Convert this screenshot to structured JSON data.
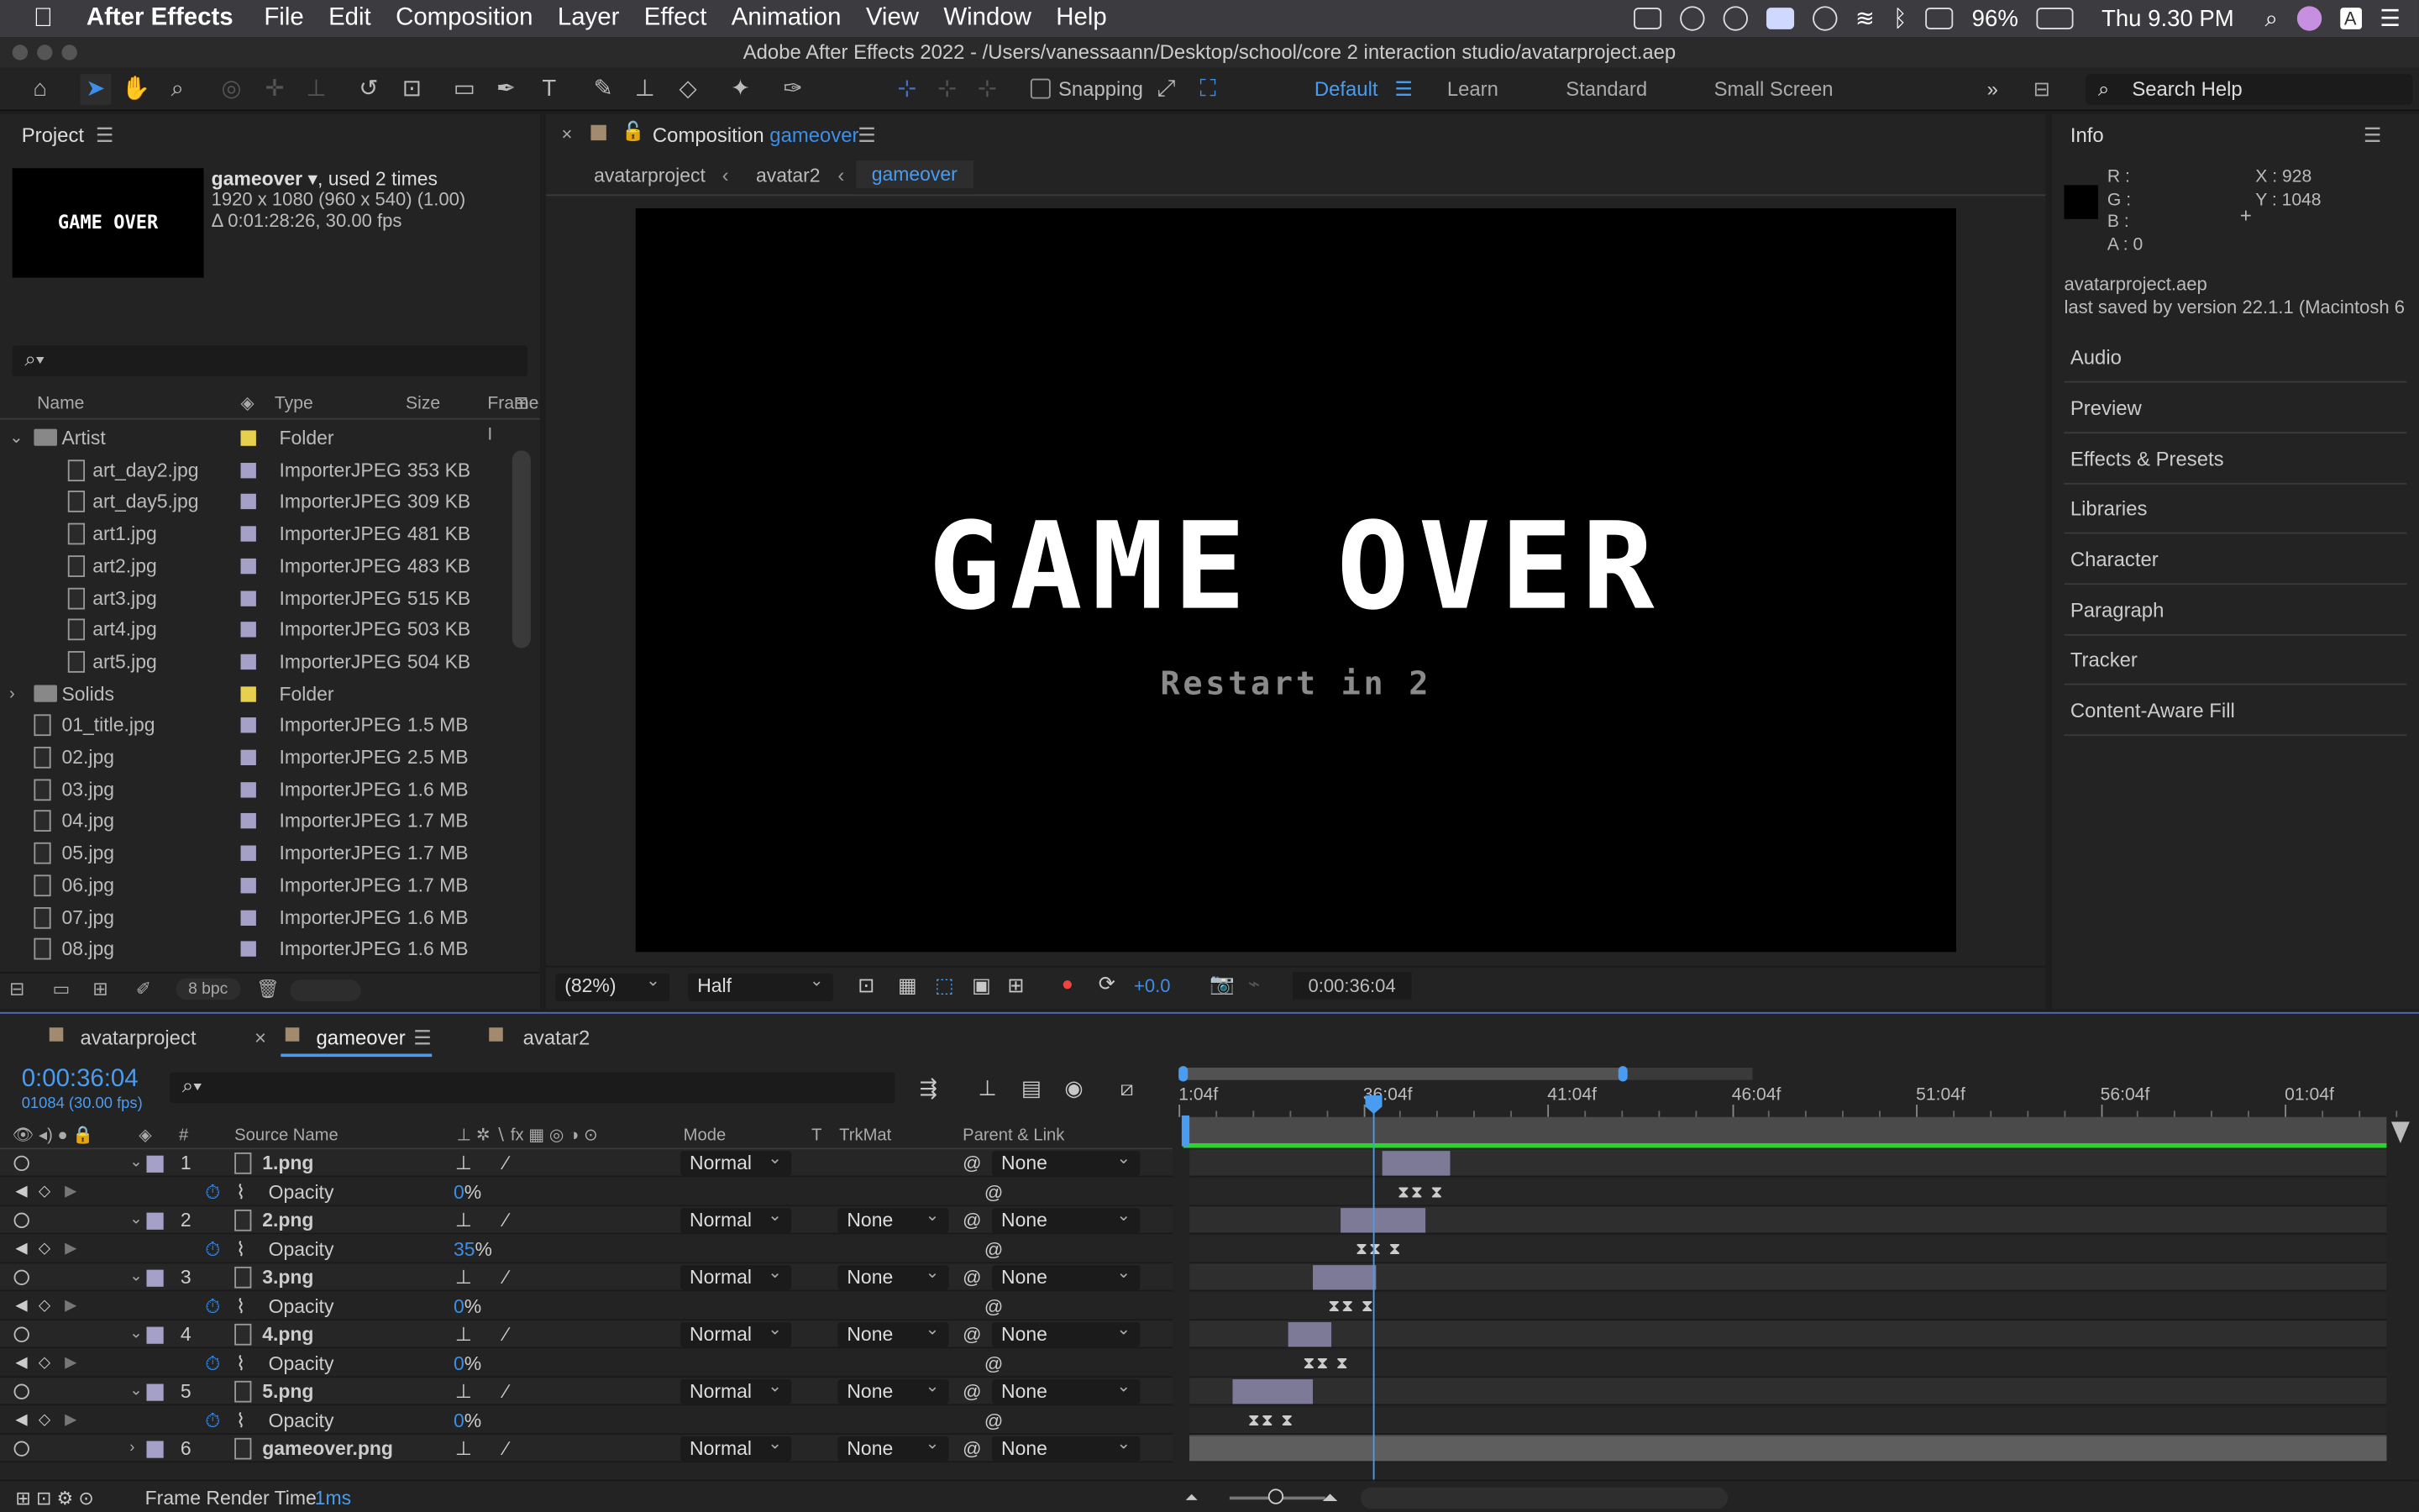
{
  "menubar": {
    "app_name": "After Effects",
    "items": [
      "File",
      "Edit",
      "Composition",
      "Layer",
      "Effect",
      "Animation",
      "View",
      "Window",
      "Help"
    ],
    "battery": "96%",
    "clock": "Thu 9.30 PM"
  },
  "window": {
    "title": "Adobe After Effects 2022 - /Users/vanessaann/Desktop/school/core 2 interaction studio/avatarproject.aep"
  },
  "toolbar": {
    "snapping": "Snapping",
    "workspaces": [
      "Default",
      "Learn",
      "Standard",
      "Small Screen"
    ],
    "search_placeholder": "Search Help"
  },
  "project": {
    "title": "Project",
    "comp_name": "gameover",
    "used": ", used 2 times",
    "dims": "1920 x 1080  (960 x 540) (1.00)",
    "duration": "Δ 0:01:28:26, 30.00 fps",
    "thumb_text": "GAME OVER",
    "columns": [
      "Name",
      "Type",
      "Size",
      "Frame I"
    ],
    "bpc": "8 bpc",
    "items": [
      {
        "name": "Artist",
        "type": "Folder",
        "size": "",
        "folder": true,
        "label_color": "#e6d04e"
      },
      {
        "name": "art_day2.jpg",
        "type": "ImporterJPEG",
        "size": "353 KB"
      },
      {
        "name": "art_day5.jpg",
        "type": "ImporterJPEG",
        "size": "309 KB"
      },
      {
        "name": "art1.jpg",
        "type": "ImporterJPEG",
        "size": "481 KB"
      },
      {
        "name": "art2.jpg",
        "type": "ImporterJPEG",
        "size": "483 KB"
      },
      {
        "name": "art3.jpg",
        "type": "ImporterJPEG",
        "size": "515 KB"
      },
      {
        "name": "art4.jpg",
        "type": "ImporterJPEG",
        "size": "503 KB"
      },
      {
        "name": "art5.jpg",
        "type": "ImporterJPEG",
        "size": "504 KB"
      },
      {
        "name": "Solids",
        "type": "Folder",
        "size": "",
        "folder": true,
        "label_color": "#e6d04e"
      },
      {
        "name": "01_title.jpg",
        "type": "ImporterJPEG",
        "size": "1.5 MB"
      },
      {
        "name": "02.jpg",
        "type": "ImporterJPEG",
        "size": "2.5 MB"
      },
      {
        "name": "03.jpg",
        "type": "ImporterJPEG",
        "size": "1.6 MB"
      },
      {
        "name": "04.jpg",
        "type": "ImporterJPEG",
        "size": "1.7 MB"
      },
      {
        "name": "05.jpg",
        "type": "ImporterJPEG",
        "size": "1.7 MB"
      },
      {
        "name": "06.jpg",
        "type": "ImporterJPEG",
        "size": "1.7 MB"
      },
      {
        "name": "07.jpg",
        "type": "ImporterJPEG",
        "size": "1.6 MB"
      },
      {
        "name": "08.jpg",
        "type": "ImporterJPEG",
        "size": "1.6 MB"
      }
    ]
  },
  "comp": {
    "label": "Composition",
    "name": "gameover",
    "breadcrumbs": [
      "avatarproject",
      "avatar2",
      "gameover"
    ],
    "headline": "GAME OVER",
    "subline": "Restart in 2",
    "zoom": "(82%)",
    "resolution": "Half",
    "exposure": "+0.0",
    "timecode": "0:00:36:04"
  },
  "info": {
    "title": "Info",
    "r": "R :",
    "g": "G :",
    "b": "B :",
    "a": "A :  0",
    "x": "X : 928",
    "y": "Y : 1048",
    "file": "avatarproject.aep",
    "saved": "last saved by version 22.1.1 (Macintosh 6",
    "panels": [
      "Audio",
      "Preview",
      "Effects & Presets",
      "Libraries",
      "Character",
      "Paragraph",
      "Tracker",
      "Content-Aware Fill"
    ]
  },
  "timeline": {
    "tabs": [
      "avatarproject",
      "gameover",
      "avatar2"
    ],
    "timecode": "0:00:36:04",
    "frames": "01084 (30.00 fps)",
    "columns": [
      "Source Name",
      "Mode",
      "T",
      "TrkMat",
      "Parent & Link"
    ],
    "ruler": [
      "1:04f",
      "36:04f",
      "41:04f",
      "46:04f",
      "51:04f",
      "56:04f",
      "01:04f"
    ],
    "footer": "Frame Render Time",
    "render_time": "1ms",
    "layers": [
      {
        "num": "1",
        "name": "1.png",
        "mode": "Normal",
        "trkmat": "",
        "parent": "None",
        "prop": "Opacity",
        "prop_value": "0",
        "bar_start": 0.161,
        "bar_len": 0.057
      },
      {
        "num": "2",
        "name": "2.png",
        "mode": "Normal",
        "trkmat": "None",
        "parent": "None",
        "prop": "Opacity",
        "prop_value": "35",
        "bar_start": 0.126,
        "bar_len": 0.071
      },
      {
        "num": "3",
        "name": "3.png",
        "mode": "Normal",
        "trkmat": "None",
        "parent": "None",
        "prop": "Opacity",
        "prop_value": "0",
        "bar_start": 0.103,
        "bar_len": 0.053
      },
      {
        "num": "4",
        "name": "4.png",
        "mode": "Normal",
        "trkmat": "None",
        "parent": "None",
        "prop": "Opacity",
        "prop_value": "0",
        "bar_start": 0.082,
        "bar_len": 0.037
      },
      {
        "num": "5",
        "name": "5.png",
        "mode": "Normal",
        "trkmat": "None",
        "parent": "None",
        "prop": "Opacity",
        "prop_value": "0",
        "bar_start": 0.036,
        "bar_len": 0.067
      },
      {
        "num": "6",
        "name": "gameover.png",
        "mode": "Normal",
        "trkmat": "None",
        "parent": "None",
        "bar_start": 0.0,
        "bar_len": 1.0
      }
    ]
  },
  "colors": {
    "accent": "#3d8ee6",
    "layer_label": "#a4a0c8",
    "bar": "#7c7a97",
    "work_area": "#2bd52b"
  }
}
